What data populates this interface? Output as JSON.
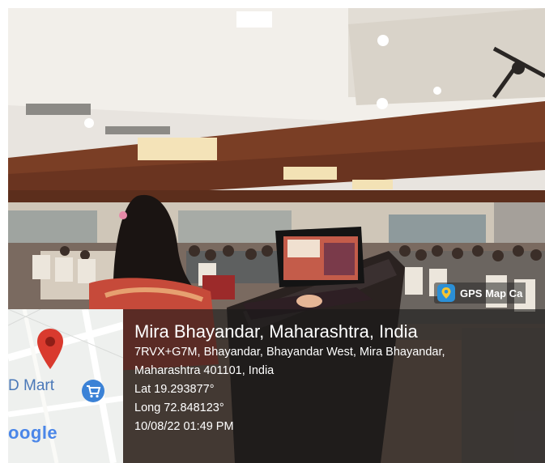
{
  "gps_badge": {
    "app_name": "GPS Map Ca",
    "icon": "map-pin-app-icon"
  },
  "location": {
    "place": "Mira Bhayandar, Maharashtra, India",
    "address_line1": "7RVX+G7M, Bhayandar, Bhayandar West, Mira Bhayandar,",
    "address_line2": "Maharashtra 401101, India",
    "latitude": "Lat 19.293877°",
    "longitude": "Long 72.848123°",
    "timestamp": "10/08/22 01:49 PM"
  },
  "map_thumbnail": {
    "store_label": "D Mart",
    "google_logo": "oogle",
    "pin_icon": "location-pin-icon",
    "cart_icon": "shopping-cart-icon"
  },
  "colors": {
    "overlay": "#191919",
    "pin_red": "#d93a2e",
    "cart_blue": "#3b82d6",
    "google_blue": "#4a86e8"
  }
}
